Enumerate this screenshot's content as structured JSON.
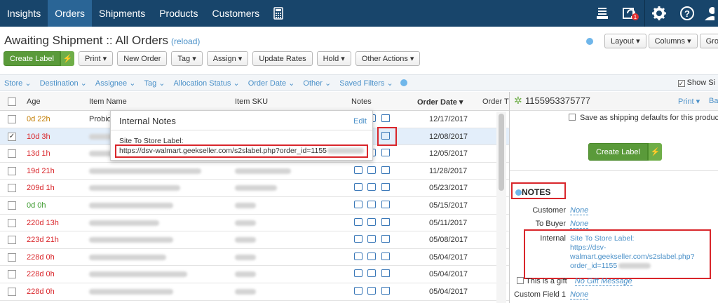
{
  "nav": {
    "tabs": [
      "Insights",
      "Orders",
      "Shipments",
      "Products",
      "Customers"
    ],
    "active": "Orders"
  },
  "page": {
    "title": "Awaiting Shipment :: All Orders",
    "reload": "(reload)"
  },
  "toolbar": {
    "create_label": "Create Label",
    "print": "Print",
    "new_order": "New Order",
    "tag": "Tag",
    "assign": "Assign",
    "update_rates": "Update Rates",
    "hold": "Hold",
    "other_actions": "Other Actions",
    "layout": "Layout",
    "columns": "Columns",
    "group": "Group"
  },
  "filters": [
    "Store",
    "Destination",
    "Assignee",
    "Tag",
    "Allocation Status",
    "Order Date",
    "Other",
    "Saved Filters"
  ],
  "show_side": "Show Si",
  "columns": {
    "age": "Age",
    "item_name": "Item Name",
    "item_sku": "Item SKU",
    "notes": "Notes",
    "order_date": "Order Date",
    "order_t": "Order T"
  },
  "rows": [
    {
      "age": "0d 22h",
      "age_color": "#c27c00",
      "item": "Probio",
      "date": "12/17/2017"
    },
    {
      "age": "10d 3h",
      "age_color": "#d9262b",
      "item": "",
      "date": "12/08/2017",
      "checked": true
    },
    {
      "age": "13d 1h",
      "age_color": "#d9262b",
      "item": "",
      "date": "12/05/2017"
    },
    {
      "age": "19d 21h",
      "age_color": "#d9262b",
      "item": "",
      "date": "11/28/2017"
    },
    {
      "age": "209d 1h",
      "age_color": "#d9262b",
      "item": "",
      "date": "05/23/2017"
    },
    {
      "age": "0d 0h",
      "age_color": "#3c9a2e",
      "item": "",
      "date": "05/15/2017"
    },
    {
      "age": "220d 13h",
      "age_color": "#d9262b",
      "item": "",
      "date": "05/11/2017"
    },
    {
      "age": "223d 21h",
      "age_color": "#d9262b",
      "item": "",
      "date": "05/08/2017"
    },
    {
      "age": "228d 0h",
      "age_color": "#d9262b",
      "item": "",
      "date": "05/04/2017"
    },
    {
      "age": "228d 0h",
      "age_color": "#d9262b",
      "item": "",
      "date": "05/04/2017"
    },
    {
      "age": "228d 0h",
      "age_color": "#d9262b",
      "item": "",
      "date": "05/04/2017"
    }
  ],
  "popup": {
    "title": "Internal Notes",
    "edit": "Edit",
    "label": "Site To Store Label:",
    "url": "https://dsv-walmart.geekseller.com/s2slabel.php?order_id=1155"
  },
  "panel": {
    "order_id": "1155953375777",
    "print": "Print",
    "ba": "Ba",
    "save_default": "Save as shipping defaults for this product",
    "create_label": "Create Label",
    "notes_heading": "NOTES",
    "customer": "Customer",
    "customer_val": "None",
    "to_buyer": "To Buyer",
    "to_buyer_val": "None",
    "internal": "Internal",
    "internal_lines": [
      "Site To Store Label:",
      "https://dsv-",
      "walmart.geekseller.com/s2slabel.php?",
      "order_id=1155"
    ],
    "gift": "This is a gift",
    "gift_val": "No Gift Message",
    "custom_field": "Custom Field 1",
    "custom_val": "None"
  }
}
